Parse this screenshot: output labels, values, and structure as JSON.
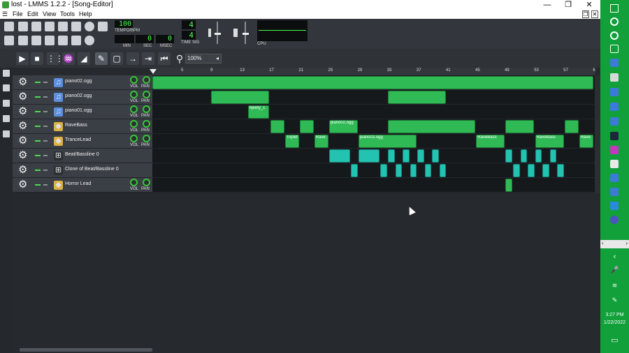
{
  "window": {
    "title": "lost - LMMS 1.2.2 - [Song-Editor]"
  },
  "menu": [
    "File",
    "Edit",
    "View",
    "Tools",
    "Help"
  ],
  "transport": {
    "tempo": "100",
    "tempo_label": "TEMPO/BPM",
    "min": "",
    "sec": "0",
    "msec": "0",
    "min_label": "MIN",
    "sec_label": "SEC",
    "msec_label": "MSEC",
    "timesig_top": "4",
    "timesig_bottom": "4",
    "timesig_label": "TIME SIG",
    "cpu_label": "CPU"
  },
  "song_editor": {
    "zoom": "100%",
    "ruler": [
      "5",
      "9",
      "13",
      "17",
      "21",
      "25",
      "29",
      "33",
      "37",
      "41",
      "45",
      "49",
      "53",
      "57",
      "6"
    ]
  },
  "track_knob_labels": {
    "vol": "VOL",
    "pan": "PAN"
  },
  "tracks": [
    {
      "name": "piano02.ogg",
      "icon": "audio-icon",
      "knobs": true,
      "clips": [
        {
          "bar": 1,
          "len": 60,
          "label": "",
          "color": "green"
        }
      ]
    },
    {
      "name": "piano02.ogg",
      "icon": "audio-icon",
      "knobs": true,
      "clips": [
        {
          "bar": 9,
          "len": 8,
          "label": "",
          "color": "green"
        },
        {
          "bar": 33,
          "len": 8,
          "label": "",
          "color": "green"
        }
      ]
    },
    {
      "name": "piano01.ogg",
      "icon": "audio-icon",
      "knobs": true,
      "clips": [
        {
          "bar": 14,
          "len": 3,
          "label": "hjeety_c",
          "color": "green"
        }
      ]
    },
    {
      "name": "RaveBass",
      "icon": "instrument-icon",
      "knobs": true,
      "clips": [
        {
          "bar": 17,
          "len": 2,
          "label": "",
          "color": "green"
        },
        {
          "bar": 21,
          "len": 2,
          "label": "",
          "color": "green"
        },
        {
          "bar": 25,
          "len": 4,
          "label": "piano02.ogg",
          "color": "green"
        },
        {
          "bar": 33,
          "len": 12,
          "label": "",
          "color": "green"
        },
        {
          "bar": 49,
          "len": 4,
          "label": "",
          "color": "green"
        },
        {
          "bar": 57,
          "len": 2,
          "label": "",
          "color": "green"
        }
      ]
    },
    {
      "name": "TranceLead",
      "icon": "instrument-icon",
      "knobs": true,
      "clips": [
        {
          "bar": 19,
          "len": 2,
          "label": "Triplet",
          "color": "green"
        },
        {
          "bar": 23,
          "len": 2,
          "label": "Rave",
          "color": "green"
        },
        {
          "bar": 29,
          "len": 8,
          "label": "piano02.ogg",
          "color": "green"
        },
        {
          "bar": 45,
          "len": 4,
          "label": "RaveBass",
          "color": "green"
        },
        {
          "bar": 53,
          "len": 4,
          "label": "RaveBass",
          "color": "green"
        },
        {
          "bar": 59,
          "len": 2,
          "label": "Rave",
          "color": "green"
        }
      ]
    },
    {
      "name": "Beat/Bassline 0",
      "icon": "beat-icon",
      "knobs": false,
      "clips": [
        {
          "bar": 25,
          "len": 3,
          "label": "",
          "color": "cyan"
        },
        {
          "bar": 29,
          "len": 3,
          "label": "",
          "color": "cyan"
        },
        {
          "bar": 33,
          "len": 1,
          "label": "",
          "color": "cyan"
        },
        {
          "bar": 35,
          "len": 1,
          "label": "",
          "color": "cyan"
        },
        {
          "bar": 37,
          "len": 1,
          "label": "",
          "color": "cyan"
        },
        {
          "bar": 39,
          "len": 1,
          "label": "",
          "color": "cyan"
        },
        {
          "bar": 49,
          "len": 1,
          "label": "",
          "color": "cyan"
        },
        {
          "bar": 51,
          "len": 1,
          "label": "",
          "color": "cyan"
        },
        {
          "bar": 53,
          "len": 1,
          "label": "",
          "color": "cyan"
        },
        {
          "bar": 55,
          "len": 1,
          "label": "",
          "color": "cyan"
        }
      ]
    },
    {
      "name": "Clone of Beat/Bassline 0",
      "icon": "beat-icon",
      "knobs": false,
      "clips": [
        {
          "bar": 28,
          "len": 1,
          "label": "",
          "color": "cyan"
        },
        {
          "bar": 32,
          "len": 1,
          "label": "",
          "color": "cyan"
        },
        {
          "bar": 34,
          "len": 1,
          "label": "",
          "color": "cyan"
        },
        {
          "bar": 36,
          "len": 1,
          "label": "",
          "color": "cyan"
        },
        {
          "bar": 38,
          "len": 1,
          "label": "",
          "color": "cyan"
        },
        {
          "bar": 40,
          "len": 1,
          "label": "",
          "color": "cyan"
        },
        {
          "bar": 50,
          "len": 1,
          "label": "",
          "color": "cyan"
        },
        {
          "bar": 52,
          "len": 1,
          "label": "",
          "color": "cyan"
        },
        {
          "bar": 54,
          "len": 1,
          "label": "",
          "color": "cyan"
        },
        {
          "bar": 56,
          "len": 1,
          "label": "",
          "color": "cyan"
        }
      ]
    },
    {
      "name": "Horror Lead",
      "icon": "instrument-icon",
      "knobs": true,
      "clips": [
        {
          "bar": 49,
          "len": 1,
          "label": "",
          "color": "green"
        }
      ]
    }
  ],
  "taskbar": {
    "time": "3:27 PM",
    "date": "1/22/2022"
  }
}
